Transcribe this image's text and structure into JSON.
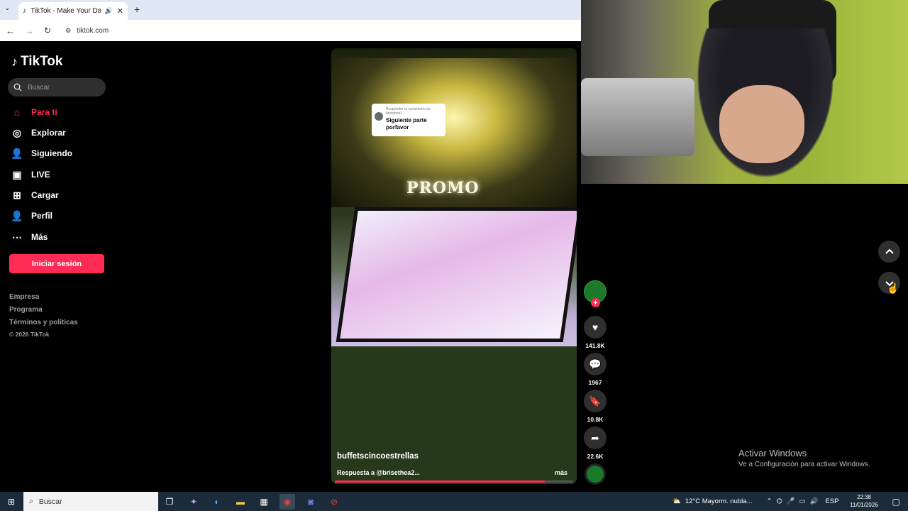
{
  "browser": {
    "tab_title": "TikTok - Make Your Day",
    "url": "tiktok.com"
  },
  "sidebar": {
    "logo_text": "TikTok",
    "search_placeholder": "Buscar",
    "nav": [
      {
        "label": "Para ti",
        "icon": "home-icon",
        "active": true
      },
      {
        "label": "Explorar",
        "icon": "compass-icon"
      },
      {
        "label": "Siguiendo",
        "icon": "following-icon"
      },
      {
        "label": "LIVE",
        "icon": "live-icon"
      },
      {
        "label": "Cargar",
        "icon": "upload-icon"
      },
      {
        "label": "Perfil",
        "icon": "profile-icon"
      },
      {
        "label": "Más",
        "icon": "more-icon"
      }
    ],
    "login_label": "Iniciar sesión",
    "footer": [
      "Empresa",
      "Programa",
      "Términos y políticas",
      "© 2026 TikTok"
    ]
  },
  "video": {
    "sign_text": "PROMO",
    "reply_bubble": {
      "small_text": "Responder al comentario de brisethea2",
      "text": "Siguiente parte porfavor"
    },
    "author": "buffetscincoestrellas",
    "caption": "Respuesta a @brisethea2...",
    "more_label": "más",
    "progress": 0.88
  },
  "actions": {
    "likes": "141.8K",
    "comments": "1967",
    "saves": "10.8K",
    "shares": "22.6K"
  },
  "watermark": {
    "line1": "Activar Windows",
    "line2": "Ve a Configuración para activar Windows."
  },
  "taskbar": {
    "search_placeholder": "Buscar",
    "weather": "12°C  Mayorm. nubla...",
    "language": "ESP",
    "time": "22:38",
    "date": "11/01/2026"
  },
  "colors": {
    "accent": "#fe2c55",
    "taskbar": "#1c2b3a"
  }
}
